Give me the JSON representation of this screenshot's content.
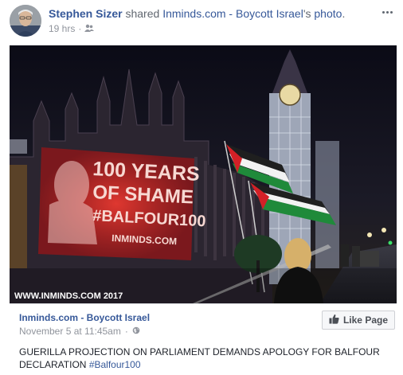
{
  "post": {
    "author": "Stephen Sizer",
    "shared_text": "shared",
    "page_name": "Inminds.com - Boycott Israel",
    "possessive": "'s",
    "photo_word": "photo",
    "period": ".",
    "time": "19 hrs",
    "separator": "·",
    "audience_icon": "friends-icon",
    "more_icon": "more-dots-icon"
  },
  "photo": {
    "projection_lines": [
      "100 YEARS",
      "OF SHAME",
      "#BALFOUR100"
    ],
    "projection_site": "INMINDS.COM",
    "watermark": "WWW.INMINDS.COM 2017"
  },
  "attachment": {
    "page_name": "Inminds.com - Boycott Israel",
    "date": "November 5 at 11:45am",
    "separator": "·",
    "privacy_icon": "globe-icon",
    "like_button": "Like Page",
    "like_icon": "thumbs-up-icon",
    "caption": "GUERILLA PROJECTION ON PARLIAMENT DEMANDS APOLOGY FOR BALFOUR DECLARATION",
    "hashtag": "#Balfour100"
  },
  "colors": {
    "link": "#365899",
    "muted": "#90949c",
    "projection": "#e02a2a",
    "flag_green": "#1f8a3a",
    "flag_red": "#d32027"
  }
}
